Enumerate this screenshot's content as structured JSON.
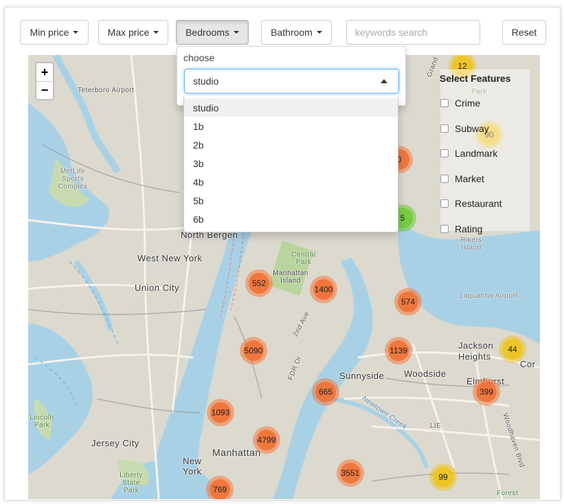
{
  "toolbar": {
    "min_price": "Min price",
    "max_price": "Max price",
    "bedrooms": "Bedrooms",
    "bathroom": "Bathroom",
    "search_placeholder": "keywords search",
    "reset": "Reset"
  },
  "dropdown": {
    "label": "choose",
    "selected": "studio",
    "options": [
      "studio",
      "1b",
      "2b",
      "3b",
      "4b",
      "5b",
      "6b"
    ]
  },
  "map": {
    "zoom_in": "+",
    "zoom_out": "−",
    "features_title": "Select Features",
    "features": [
      "Crime",
      "Subway",
      "Landmark",
      "Market",
      "Restaurant",
      "Rating"
    ],
    "places": {
      "teterboro": "Teterboro Airport",
      "metlife": "MetLife Sports Complex",
      "north_bergen": "North Bergen",
      "west_new_york": "West New York",
      "union_city": "Union City",
      "central_park": "Central Park",
      "manhattan_island": "Manhattan Island",
      "jersey_city": "Jersey City",
      "new_york": "New York",
      "manhattan": "Manhattan",
      "liberty": "Liberty State Park",
      "lincoln_park": "Lincoln Park",
      "sunnyside": "Sunnyside",
      "woodside": "Woodside",
      "jackson_heights": "Jackson Heights",
      "elmhurst": "Elmhurst",
      "rikers": "Rikers Island",
      "laguardia": "Laguardia Airport",
      "forest": "Forest",
      "grand": "Grand",
      "park": "Park",
      "fdr": "FDR Dr",
      "second_ave": "2nd Ave",
      "lie": "LIE",
      "woodhaven": "Woodhaven Blvd",
      "newtown": "Newtown Creek",
      "cor": "Cor"
    },
    "clusters": [
      {
        "label": "12",
        "color": "yellow"
      },
      {
        "label": "90",
        "color": "yellow"
      },
      {
        "label": "0",
        "color": "orange"
      },
      {
        "label": "5",
        "color": "green"
      },
      {
        "label": "552",
        "color": "orange"
      },
      {
        "label": "1400",
        "color": "orange"
      },
      {
        "label": "574",
        "color": "orange"
      },
      {
        "label": "5090",
        "color": "orange"
      },
      {
        "label": "1139",
        "color": "orange"
      },
      {
        "label": "44",
        "color": "yellow"
      },
      {
        "label": "665",
        "color": "orange"
      },
      {
        "label": "399",
        "color": "orange"
      },
      {
        "label": "1093",
        "color": "orange"
      },
      {
        "label": "4799",
        "color": "orange"
      },
      {
        "label": "3551",
        "color": "orange"
      },
      {
        "label": "99",
        "color": "yellow"
      },
      {
        "label": "769",
        "color": "orange"
      }
    ]
  }
}
